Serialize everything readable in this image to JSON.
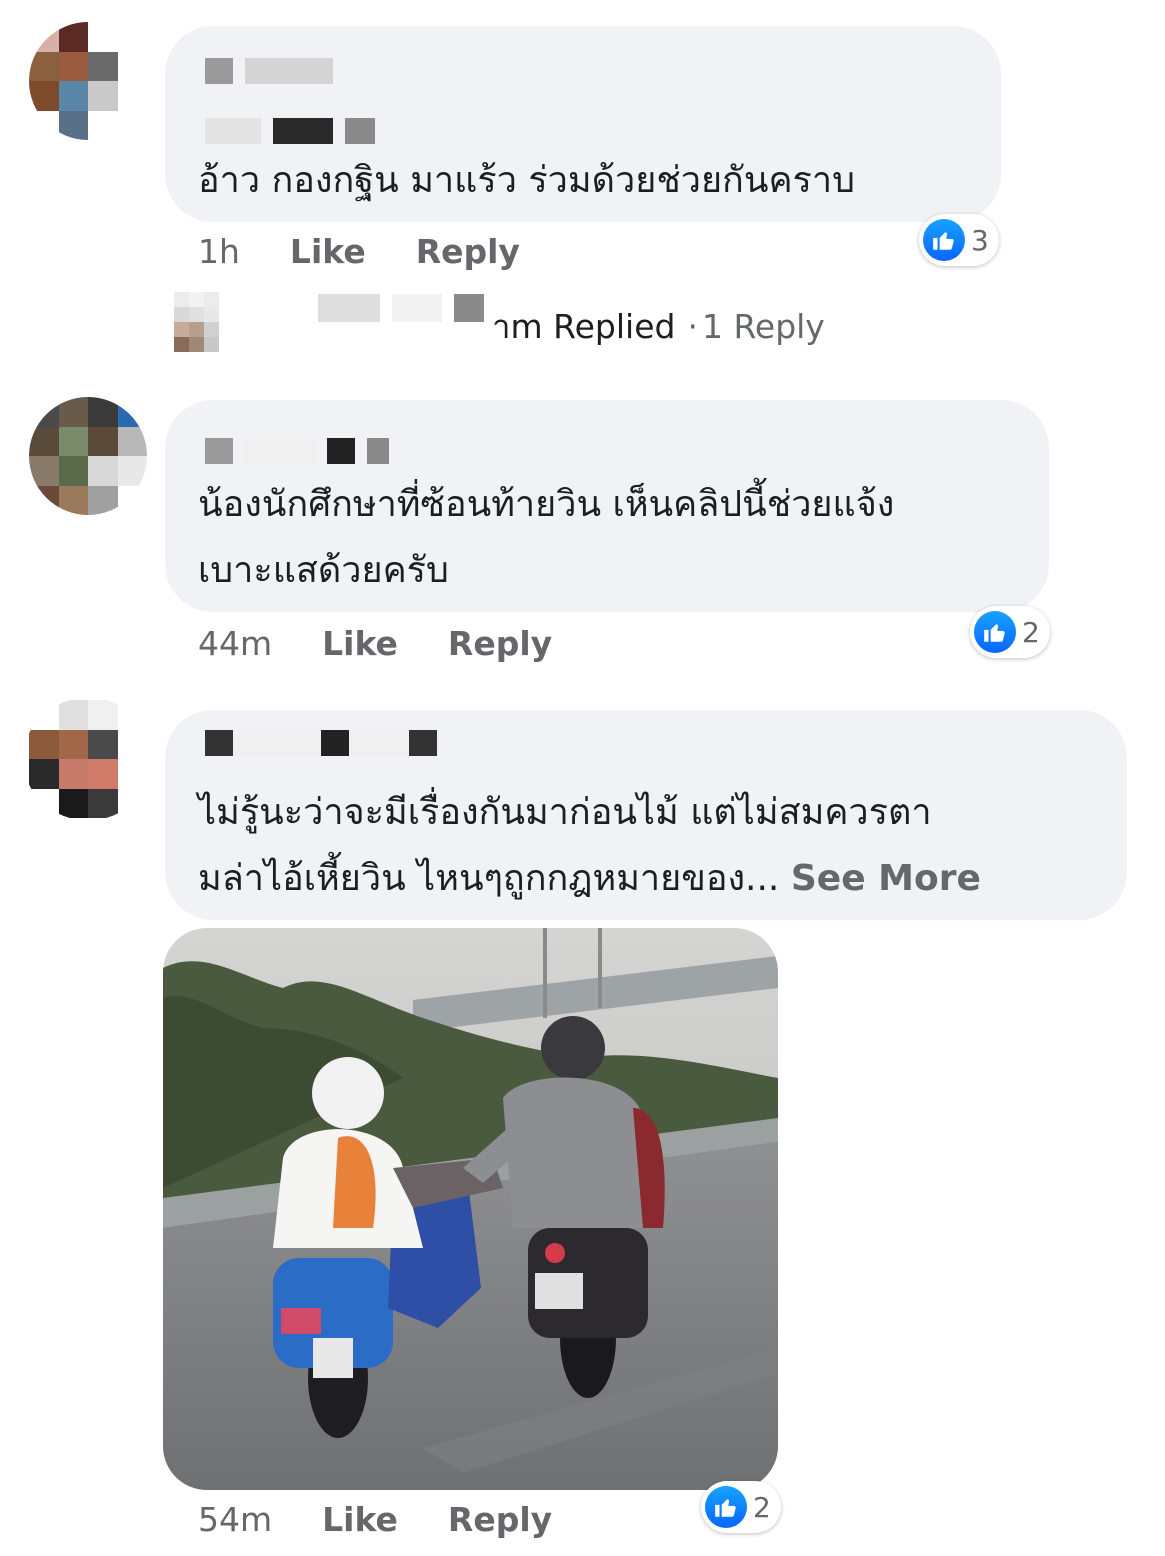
{
  "comments": [
    {
      "text_lines": [
        "อ้าว กองกฐิน มาแร้ว ร่วมด้วยช่วยกันคราบ"
      ],
      "time": "1h",
      "like_label": "Like",
      "reply_label": "Reply",
      "reaction_count": "3",
      "reply_summary": {
        "prefix": "าm Replied",
        "separator": "·",
        "link": "1 Reply"
      }
    },
    {
      "text_lines": [
        "น้องนักศึกษาที่ซ้อนท้ายวิน เห็นคลิปนี้ช่วยแจ้ง",
        "เบาะแสด้วยครับ"
      ],
      "time": "44m",
      "like_label": "Like",
      "reply_label": "Reply",
      "reaction_count": "2"
    },
    {
      "text_lines": [
        "ไม่รู้นะว่าจะมีเรื่องกันมาก่อนไม้ แต่ไม่สมควรตา",
        "มล่าไอ้เหี้ยวิน ไหนๆถูกกฎหมายของ..."
      ],
      "see_more": "See More",
      "time": "54m",
      "like_label": "Like",
      "reply_label": "Reply",
      "reaction_count": "2"
    }
  ],
  "colors": {
    "bubble": "#f0f2f5",
    "meta_text": "#65676b",
    "like_blue": "#0866ff"
  },
  "icons": {
    "reaction": "like-thumb-icon"
  }
}
